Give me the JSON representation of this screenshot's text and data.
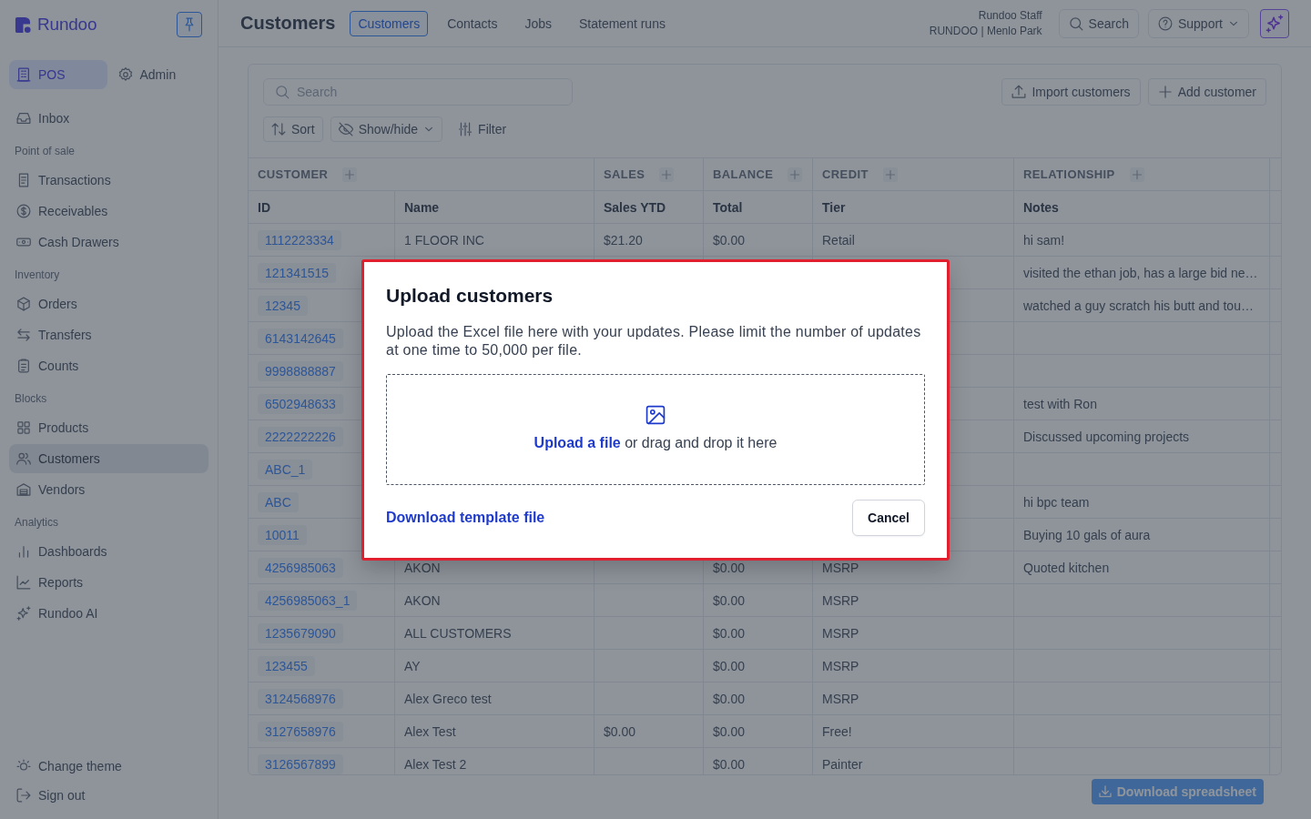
{
  "sidebar": {
    "logo": "Rundoo",
    "modes": [
      {
        "label": "POS",
        "selected": true
      },
      {
        "label": "Admin",
        "selected": false
      }
    ],
    "nav": [
      {
        "items": [
          {
            "label": "Inbox",
            "selected": false
          }
        ]
      },
      {
        "title": "Point of sale",
        "items": [
          {
            "label": "Transactions",
            "selected": false
          },
          {
            "label": "Receivables",
            "selected": false
          },
          {
            "label": "Cash Drawers",
            "selected": false
          }
        ]
      },
      {
        "title": "Inventory",
        "items": [
          {
            "label": "Orders",
            "selected": false
          },
          {
            "label": "Transfers",
            "selected": false
          },
          {
            "label": "Counts",
            "selected": false
          }
        ]
      },
      {
        "title": "Blocks",
        "items": [
          {
            "label": "Products",
            "selected": false
          },
          {
            "label": "Customers",
            "selected": true
          },
          {
            "label": "Vendors",
            "selected": false
          }
        ]
      },
      {
        "title": "Analytics",
        "items": [
          {
            "label": "Dashboards",
            "selected": false
          },
          {
            "label": "Reports",
            "selected": false
          },
          {
            "label": "Rundoo AI",
            "selected": false
          }
        ]
      }
    ],
    "bottom_items": [
      "Change theme",
      "Sign out"
    ]
  },
  "header": {
    "title": "Customers",
    "tabs": [
      {
        "label": "Customers",
        "selected": true
      },
      {
        "label": "Contacts",
        "selected": false
      },
      {
        "label": "Jobs",
        "selected": false
      },
      {
        "label": "Statement runs",
        "selected": false
      }
    ],
    "user": {
      "name": "Rundoo Staff",
      "location": "RUNDOO | Menlo Park"
    },
    "search_button": "Search",
    "support_button": "Support"
  },
  "panel": {
    "search": {
      "placeholder": "Search"
    },
    "actions": [
      "Import customers",
      "Add customer"
    ],
    "toolbar": [
      {
        "label": "Sort",
        "kind": "button"
      },
      {
        "label": "Show/hide",
        "kind": "dropdown"
      },
      {
        "label": "Filter",
        "kind": "plain"
      }
    ],
    "table": {
      "groups": [
        {
          "label": "CUSTOMER",
          "columns": [
            "ID",
            "Name"
          ]
        },
        {
          "label": "SALES",
          "columns": [
            "Sales YTD"
          ]
        },
        {
          "label": "BALANCE",
          "columns": [
            "Total"
          ]
        },
        {
          "label": "CREDIT",
          "columns": [
            "Tier"
          ]
        },
        {
          "label": "RELATIONSHIP",
          "columns": [
            "Notes"
          ]
        }
      ],
      "rows": [
        {
          "id": "1112223334",
          "name": "1 FLOOR INC",
          "sales_ytd": "$21.20",
          "total": "$0.00",
          "tier": "Retail",
          "notes": "hi sam!"
        },
        {
          "id": "121341515",
          "notes": "visited the ethan job, has a large bid ne…"
        },
        {
          "id": "12345",
          "notes": "watched a guy scratch his butt and tou…"
        },
        {
          "id": "6143142645"
        },
        {
          "id": "9998888887"
        },
        {
          "id": "6502948633",
          "notes": "test with Ron"
        },
        {
          "id": "2222222226",
          "notes": "Discussed upcoming projects"
        },
        {
          "id": "ABC_1"
        },
        {
          "id": "ABC",
          "notes": "hi bpc team"
        },
        {
          "id": "10011",
          "notes": "Buying 10 gals of aura"
        },
        {
          "id": "4256985063",
          "name": "AKON",
          "total": "$0.00",
          "tier": "MSRP",
          "notes": "Quoted kitchen"
        },
        {
          "id": "4256985063_1",
          "name": "AKON",
          "total": "$0.00",
          "tier": "MSRP"
        },
        {
          "id": "1235679090",
          "name": "ALL CUSTOMERS",
          "total": "$0.00",
          "tier": "MSRP"
        },
        {
          "id": "123455",
          "name": "AY",
          "total": "$0.00",
          "tier": "MSRP"
        },
        {
          "id": "3124568976",
          "name": "Alex Greco test",
          "total": "$0.00",
          "tier": "MSRP"
        },
        {
          "id": "3127658976",
          "name": "Alex Test",
          "sales_ytd": "$0.00",
          "total": "$0.00",
          "tier": "Free!"
        },
        {
          "id": "3126567899",
          "name": "Alex Test 2",
          "total": "$0.00",
          "tier": "Painter"
        }
      ]
    }
  },
  "footer": {
    "download_button": "Download spreadsheet"
  },
  "modal": {
    "title": "Upload customers",
    "description": "Upload the Excel file here with your updates. Please limit the number of updates at one time to 50,000 per file.",
    "dropzone": {
      "link": "Upload a file",
      "text": "or drag and drop it here"
    },
    "template_link": "Download template file",
    "cancel_button": "Cancel"
  }
}
